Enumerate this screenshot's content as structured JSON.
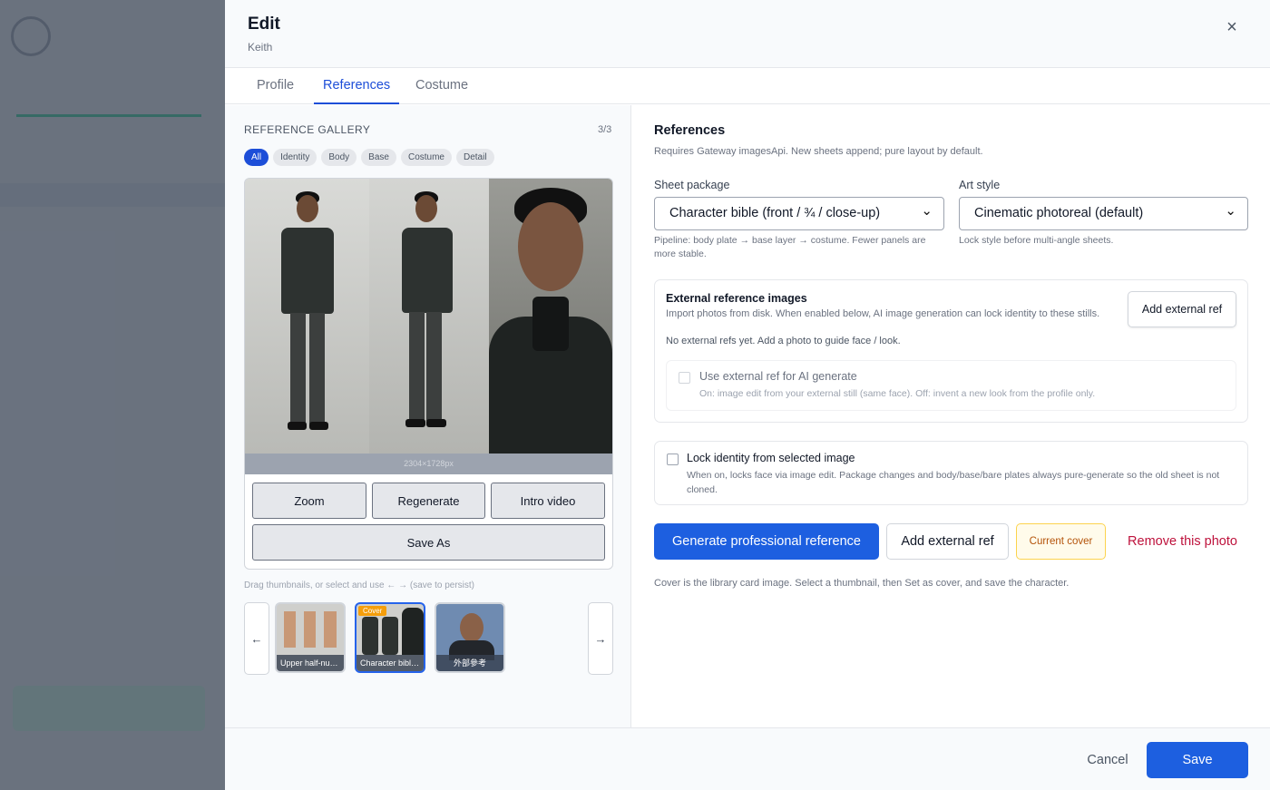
{
  "background": {
    "colors": {
      "overlay": "#374151",
      "accent": "#34d399"
    }
  },
  "modal": {
    "title": "Edit",
    "subtitle": "Keith",
    "close_icon": "×"
  },
  "tabs": [
    {
      "label": "Profile",
      "active": false
    },
    {
      "label": "References",
      "active": true
    },
    {
      "label": "Costume",
      "active": false
    }
  ],
  "gallery": {
    "label": "REFERENCE GALLERY",
    "count": "3/3",
    "filters": [
      "All",
      "Identity",
      "Body",
      "Base",
      "Costume",
      "Detail"
    ],
    "active_filter": "All",
    "image_dims": "2304×1728px",
    "buttons": {
      "zoom": "Zoom",
      "regenerate": "Regenerate",
      "intro_video": "Intro video",
      "save_as": "Save As"
    },
    "drag_hint": "Drag thumbnails, or select and use ← → (save to persist)",
    "prev_arrow": "←",
    "next_arrow": "→",
    "thumbnails": [
      {
        "caption": "Upper half-nud…",
        "selected": false,
        "cover": false
      },
      {
        "caption": "Character bible…",
        "selected": true,
        "cover": true,
        "badge": "Cover"
      },
      {
        "caption": "外部參考",
        "selected": false,
        "cover": false
      }
    ]
  },
  "references": {
    "title": "References",
    "subtitle": "Requires Gateway imagesApi. New sheets append; pure layout by default.",
    "sheet_package": {
      "label": "Sheet package",
      "value": "Character bible (front / ¾ / close-up)",
      "hint": "Pipeline: body plate → base layer → costume. Fewer panels are more stable."
    },
    "art_style": {
      "label": "Art style",
      "value": "Cinematic photoreal (default)",
      "hint": "Lock style before multi-angle sheets."
    },
    "external": {
      "title": "External reference images",
      "desc": "Import photos from disk. When enabled below, AI image generation can lock identity to these stills.",
      "add_label": "Add external ref",
      "empty": "No external refs yet. Add a photo to guide face / look.",
      "use_title": "Use external ref for AI generate",
      "use_desc": "On: image edit from your external still (same face). Off: invent a new look from the profile only."
    },
    "lock": {
      "title": "Lock identity from selected image",
      "desc": "When on, locks face via image edit. Package changes and body/base/bare plates always pure-generate so the old sheet is not cloned."
    },
    "actions": {
      "generate": "Generate professional reference",
      "add_external": "Add external ref",
      "current_cover": "Current cover",
      "remove": "Remove this photo"
    },
    "cover_note": "Cover is the library card image. Select a thumbnail, then Set as cover, and save the character."
  },
  "footer": {
    "cancel": "Cancel",
    "save": "Save"
  },
  "colors": {
    "primary": "#1d5fe0",
    "tab_active": "#1d4ed8",
    "danger": "#be123c",
    "cover_amber": "#b45309"
  }
}
